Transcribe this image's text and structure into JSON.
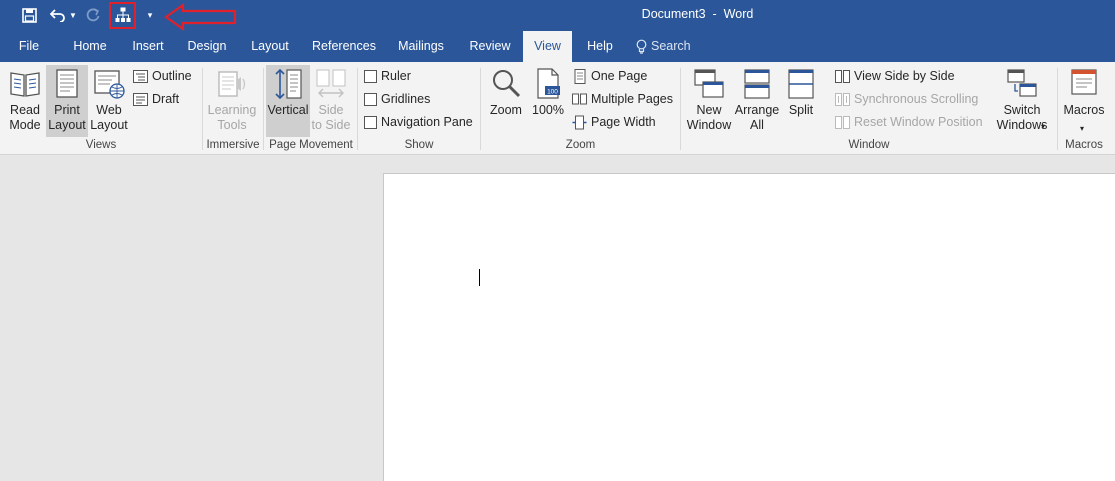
{
  "app": {
    "document_name": "Document3",
    "separator": "  -  ",
    "app_name": "Word"
  },
  "qat": {
    "save_icon": "save-icon",
    "undo_icon": "undo-icon",
    "redo_icon": "redo-icon",
    "custom_icon": "org-chart-icon",
    "customize_icon": "customize-qat-icon"
  },
  "tabs": [
    {
      "label": "File"
    },
    {
      "label": "Home"
    },
    {
      "label": "Insert"
    },
    {
      "label": "Design"
    },
    {
      "label": "Layout"
    },
    {
      "label": "References"
    },
    {
      "label": "Mailings"
    },
    {
      "label": "Review"
    },
    {
      "label": "View",
      "active": true
    },
    {
      "label": "Help"
    }
  ],
  "search": {
    "label": "Search"
  },
  "ribbon": {
    "views": {
      "label": "Views",
      "read_mode": "Read\nMode",
      "print_layout": "Print\nLayout",
      "web_layout": "Web\nLayout",
      "outline": "Outline",
      "draft": "Draft"
    },
    "immersive": {
      "label": "Immersive",
      "learning_tools": "Learning\nTools"
    },
    "page_movement": {
      "label": "Page Movement",
      "vertical": "Vertical",
      "side_to_side": "Side\nto Side"
    },
    "show": {
      "label": "Show",
      "ruler": "Ruler",
      "gridlines": "Gridlines",
      "navigation_pane": "Navigation Pane"
    },
    "zoom": {
      "label": "Zoom",
      "zoom": "Zoom",
      "hundred": "100%",
      "one_page": "One Page",
      "multiple_pages": "Multiple Pages",
      "page_width": "Page Width"
    },
    "window": {
      "label": "Window",
      "new_window": "New\nWindow",
      "arrange_all": "Arrange\nAll",
      "split": "Split",
      "view_side_by_side": "View Side by Side",
      "sync_scrolling": "Synchronous Scrolling",
      "reset_position": "Reset Window Position",
      "switch_windows": "Switch\nWindows"
    },
    "macros": {
      "label": "Macros",
      "macros": "Macros"
    }
  },
  "colors": {
    "title_bar": "#2b579a",
    "ribbon": "#f3f3f3",
    "annotation": "#e0212b"
  }
}
